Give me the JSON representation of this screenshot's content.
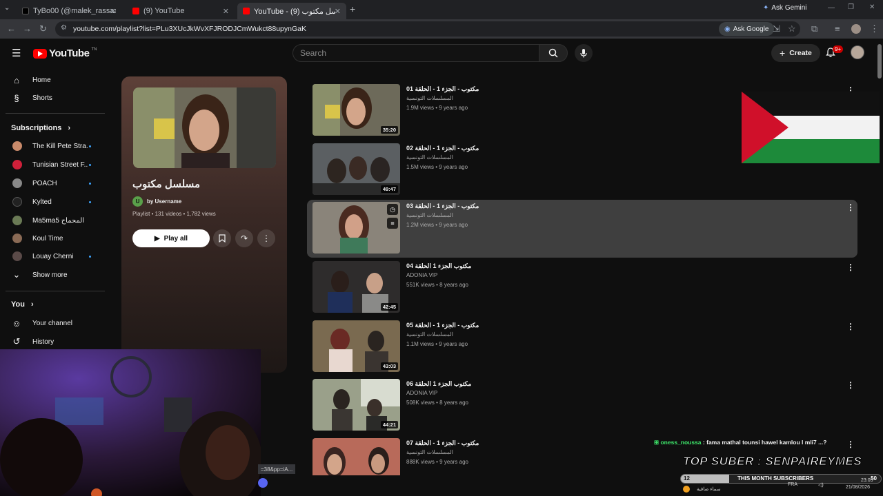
{
  "browser": {
    "tabs": [
      {
        "title": "TyBo00 (@malek_rassaa) | TikTok",
        "active": false
      },
      {
        "title": "(9) YouTube",
        "active": false
      },
      {
        "title": "YouTube - مسلسل مكتوب (9)",
        "active": true
      }
    ],
    "url": "youtube.com/playlist?list=PLu3XUcJkWvXFJRODJCmWukct88upynGaK",
    "ask_gemini": "Ask Gemini",
    "ask_google": "Ask Google",
    "status_url": "=38&pp=iA..."
  },
  "masthead": {
    "logo_text": "YouTube",
    "logo_tn": "TN",
    "search_placeholder": "Search",
    "create_label": "Create",
    "notification_count": "9+"
  },
  "sidebar": {
    "home": "Home",
    "shorts": "Shorts",
    "subscriptions_heading": "Subscriptions",
    "subscriptions": [
      {
        "name": "The Kill Pete Stra...",
        "new": true,
        "color": "#c98a6a"
      },
      {
        "name": "Tunisian Street F...",
        "new": true,
        "color": "#d0203a"
      },
      {
        "name": "POACH",
        "new": true,
        "color": "#888888"
      },
      {
        "name": "Kylted",
        "new": true,
        "color": "#222222"
      },
      {
        "name": "Ma5ma5 المحماح",
        "new": false,
        "color": "#6a7a55"
      },
      {
        "name": "Koul Time",
        "new": false,
        "color": "#8a6a55"
      },
      {
        "name": "Louay Cherni",
        "new": true,
        "color": "#5a4a48"
      }
    ],
    "show_more": "Show more",
    "you_heading": "You",
    "your_channel": "Your channel",
    "history": "History"
  },
  "playlist": {
    "title": "مسلسل مكتوب",
    "owner": "by Username",
    "owner_initial": "U",
    "meta": "Playlist • 131 videos • 1,782 views",
    "play_all": "Play all"
  },
  "videos": [
    {
      "title": "مكتوب - الجزء 1 - الحلقة 01",
      "channel": "المسلسلات التونسية",
      "meta": "1.9M views • 9 years ago",
      "duration": "35:20"
    },
    {
      "title": "مكتوب - الجزء 1 - الحلقة 02",
      "channel": "المسلسلات التونسية",
      "meta": "1.5M views • 9 years ago",
      "duration": "49:47"
    },
    {
      "title": "مكتوب - الجزء 1 - الحلقة 03",
      "channel": "المسلسلات التونسية",
      "meta": "1.2M views • 9 years ago",
      "duration": ""
    },
    {
      "title": "مكتوب الجزء 1 الحلقة 04",
      "channel": "ADONIA VIP",
      "meta": "551K views • 8 years ago",
      "duration": "42:45"
    },
    {
      "title": "مكتوب - الجزء 1 - الحلقة 05",
      "channel": "المسلسلات التونسية",
      "meta": "1.1M views • 9 years ago",
      "duration": "43:03"
    },
    {
      "title": "مكتوب الجزء 1 الحلقة 06",
      "channel": "ADONIA VIP",
      "meta": "508K views • 8 years ago",
      "duration": "44:21"
    },
    {
      "title": "مكتوب - الجزء 1 - الحلقة 07",
      "channel": "المسلسلات التونسية",
      "meta": "888K views • 9 years ago",
      "duration": ""
    }
  ],
  "overlay": {
    "chat_user": "oness_noussa",
    "chat_message": ": fama mathal tounsi hawel kamlou l mli7 ...?",
    "top_suber": "TOP SUBER : SENPAIREYMES",
    "subs_current": "12",
    "subs_label": "THIS MONTH SUBSCRIBERS",
    "subs_goal": "50",
    "subs_progress": 0.24,
    "weather": "سماء صافية",
    "lang": "FRA",
    "time": "23:05",
    "date": "21/08/2026"
  },
  "colors": {
    "accent_red": "#ff0000",
    "sub_dot": "#3ea6ff",
    "chat_name": "#3ee86b"
  }
}
